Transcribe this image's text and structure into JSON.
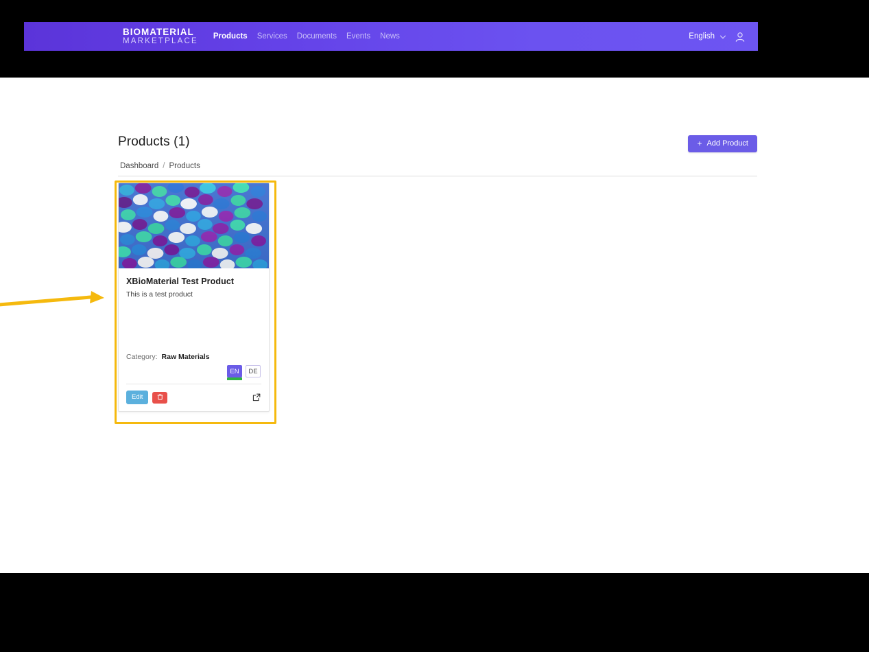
{
  "navbar": {
    "brand_line1": "BIOMATERIAL",
    "brand_line2": "MARKETPLACE",
    "links": [
      {
        "label": "Products",
        "active": true
      },
      {
        "label": "Services",
        "active": false
      },
      {
        "label": "Documents",
        "active": false
      },
      {
        "label": "Events",
        "active": false
      },
      {
        "label": "News",
        "active": false
      }
    ],
    "language": "English",
    "chevron_icon": "chevron-down-icon",
    "account_icon": "user-account-icon",
    "accent_color": "#6b5ce7"
  },
  "header": {
    "title": "Products (1)",
    "add_button_label": "Add Product",
    "add_button_plus": "+"
  },
  "breadcrumb": {
    "items": [
      "Dashboard",
      "Products"
    ],
    "separator": "/"
  },
  "annotation": {
    "highlight_color": "#F5B90E",
    "arrow_icon": "arrow-right-annotation"
  },
  "product_card": {
    "image_alt": "colored plastic pellets",
    "title": "XBioMaterial Test Product",
    "description": "This is a test product",
    "category_label": "Category:",
    "category_value": "Raw Materials",
    "languages": [
      {
        "code": "EN",
        "active": true
      },
      {
        "code": "DE",
        "active": false
      }
    ],
    "edit_label": "Edit",
    "delete_icon": "trash-icon",
    "external_link_icon": "external-link-icon"
  }
}
